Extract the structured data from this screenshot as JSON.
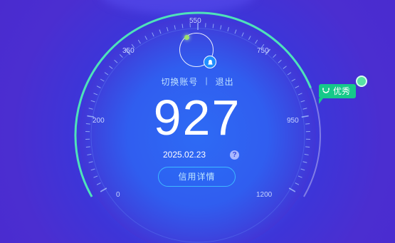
{
  "gauge": {
    "ticks": [
      "0",
      "200",
      "350",
      "550",
      "750",
      "950",
      "1200"
    ],
    "score": "927",
    "score_fraction": 0.78
  },
  "account": {
    "switch_label": "切换账号",
    "separator": "|",
    "logout_label": "退出"
  },
  "date": "2025.02.23",
  "help_label": "?",
  "detail_button": "信用详情",
  "grade_label": "优秀",
  "colors": {
    "accent_green": "#16c98a",
    "button_border": "#3fb9ff"
  }
}
